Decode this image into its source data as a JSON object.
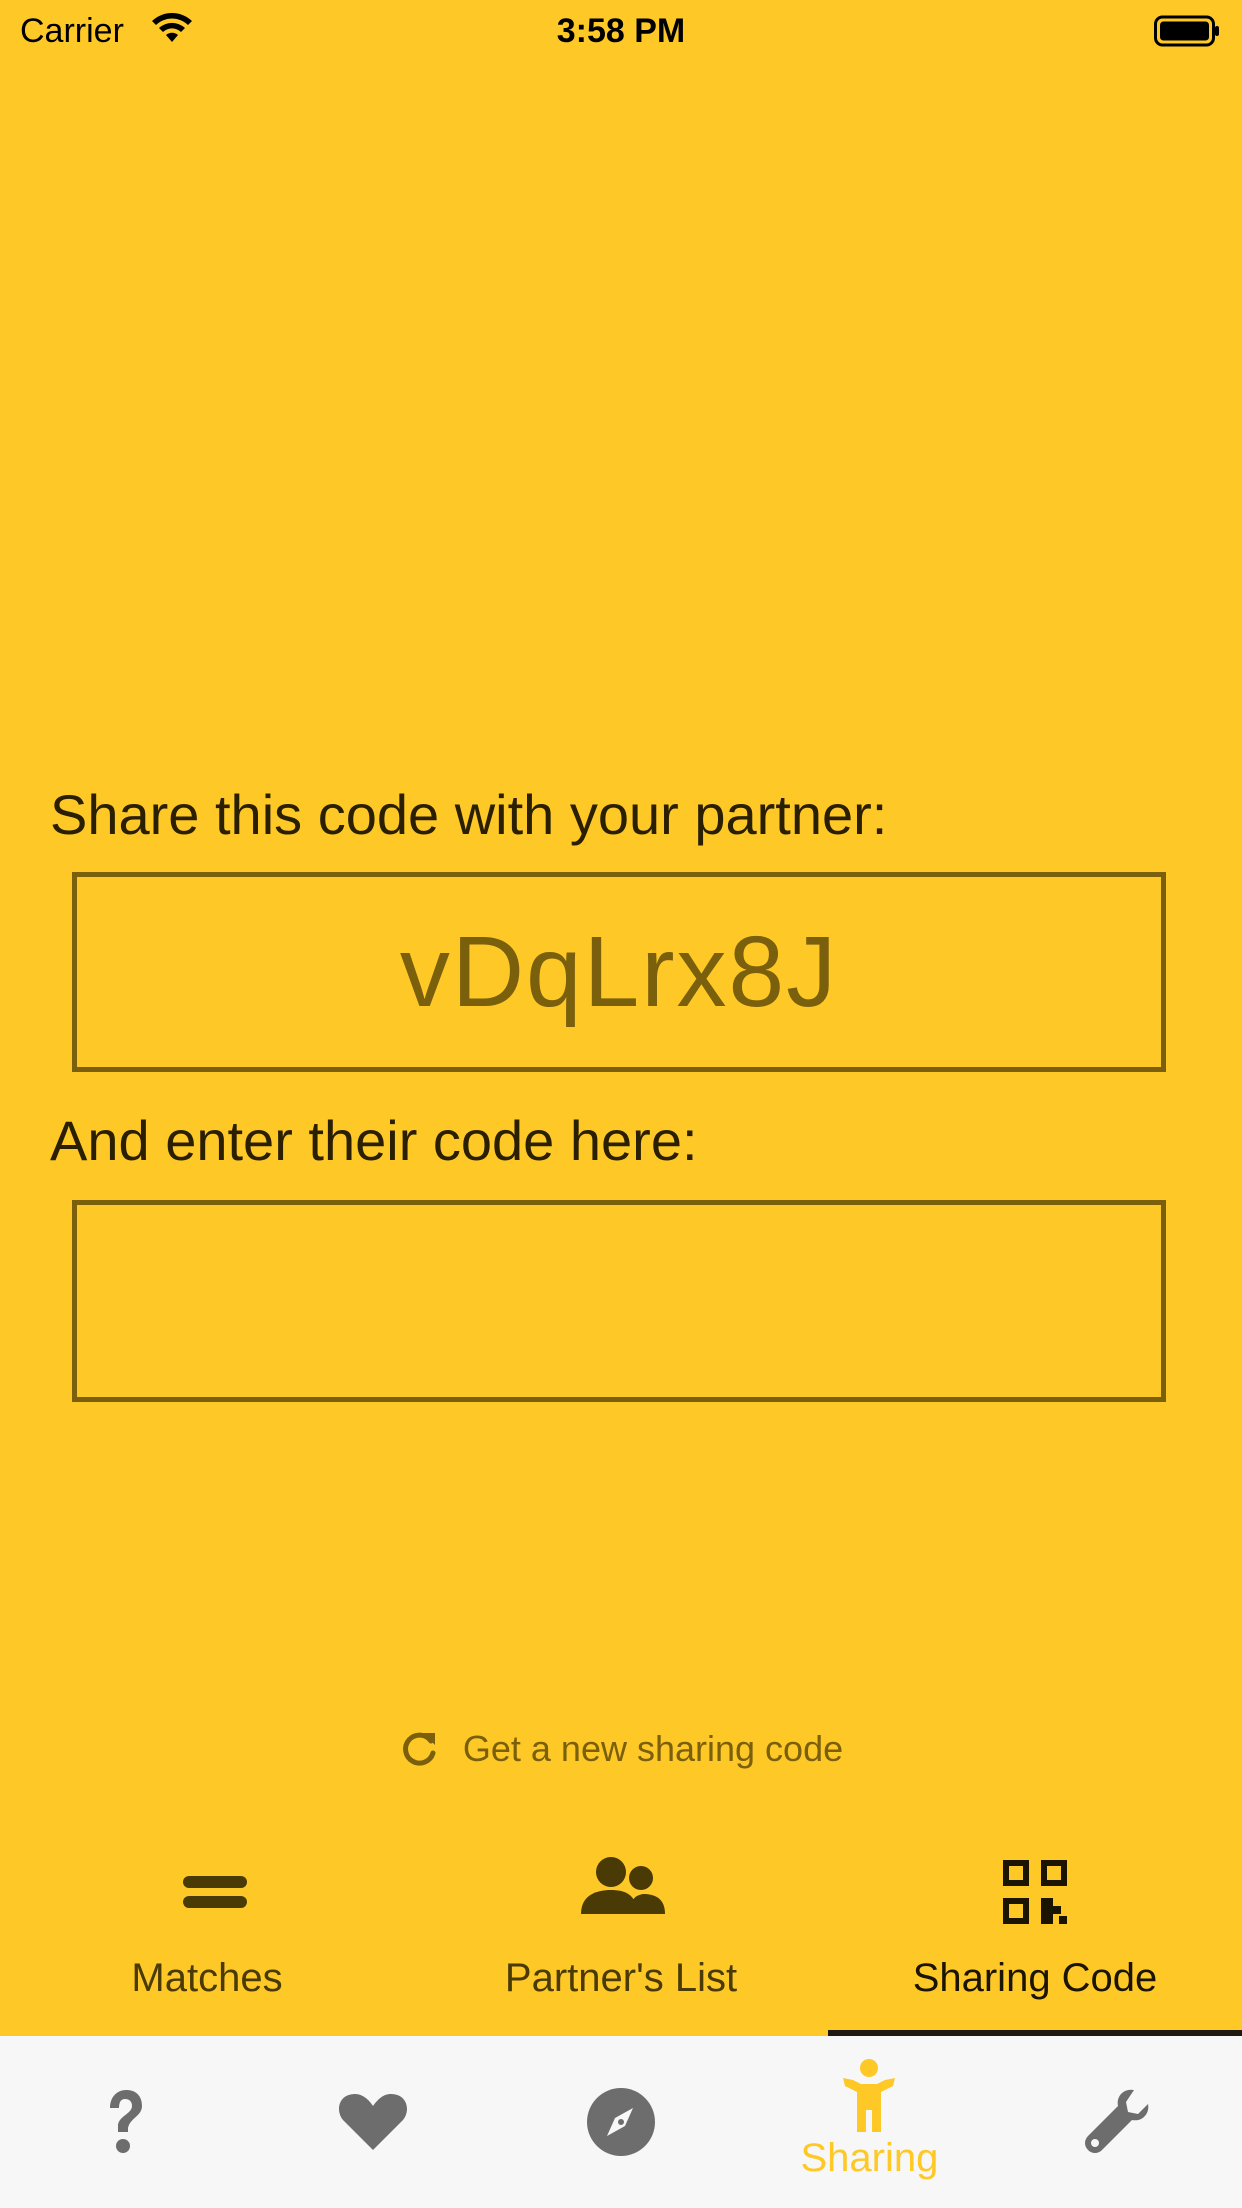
{
  "status_bar": {
    "carrier": "Carrier",
    "time": "3:58 PM"
  },
  "sharing": {
    "share_label": "Share this code with your partner:",
    "code": "vDqLrx8J",
    "enter_label": "And enter their code here:",
    "input_value": "",
    "new_code_label": "Get a new sharing code"
  },
  "top_tabs": [
    {
      "label": "Matches",
      "icon": "equals-icon"
    },
    {
      "label": "Partner's List",
      "icon": "users-icon"
    },
    {
      "label": "Sharing Code",
      "icon": "qr-code-icon",
      "active": true
    }
  ],
  "bottom_tabs": [
    {
      "icon": "question-icon",
      "label": ""
    },
    {
      "icon": "heart-icon",
      "label": ""
    },
    {
      "icon": "compass-icon",
      "label": ""
    },
    {
      "icon": "person-icon",
      "label": "Sharing",
      "active": true
    },
    {
      "icon": "wrench-icon",
      "label": ""
    }
  ],
  "colors": {
    "background": "#FEC827",
    "accent_dark": "#7a5f0c",
    "tab_bar": "#F7F7F7",
    "inactive_icon": "#6d6d6d"
  }
}
